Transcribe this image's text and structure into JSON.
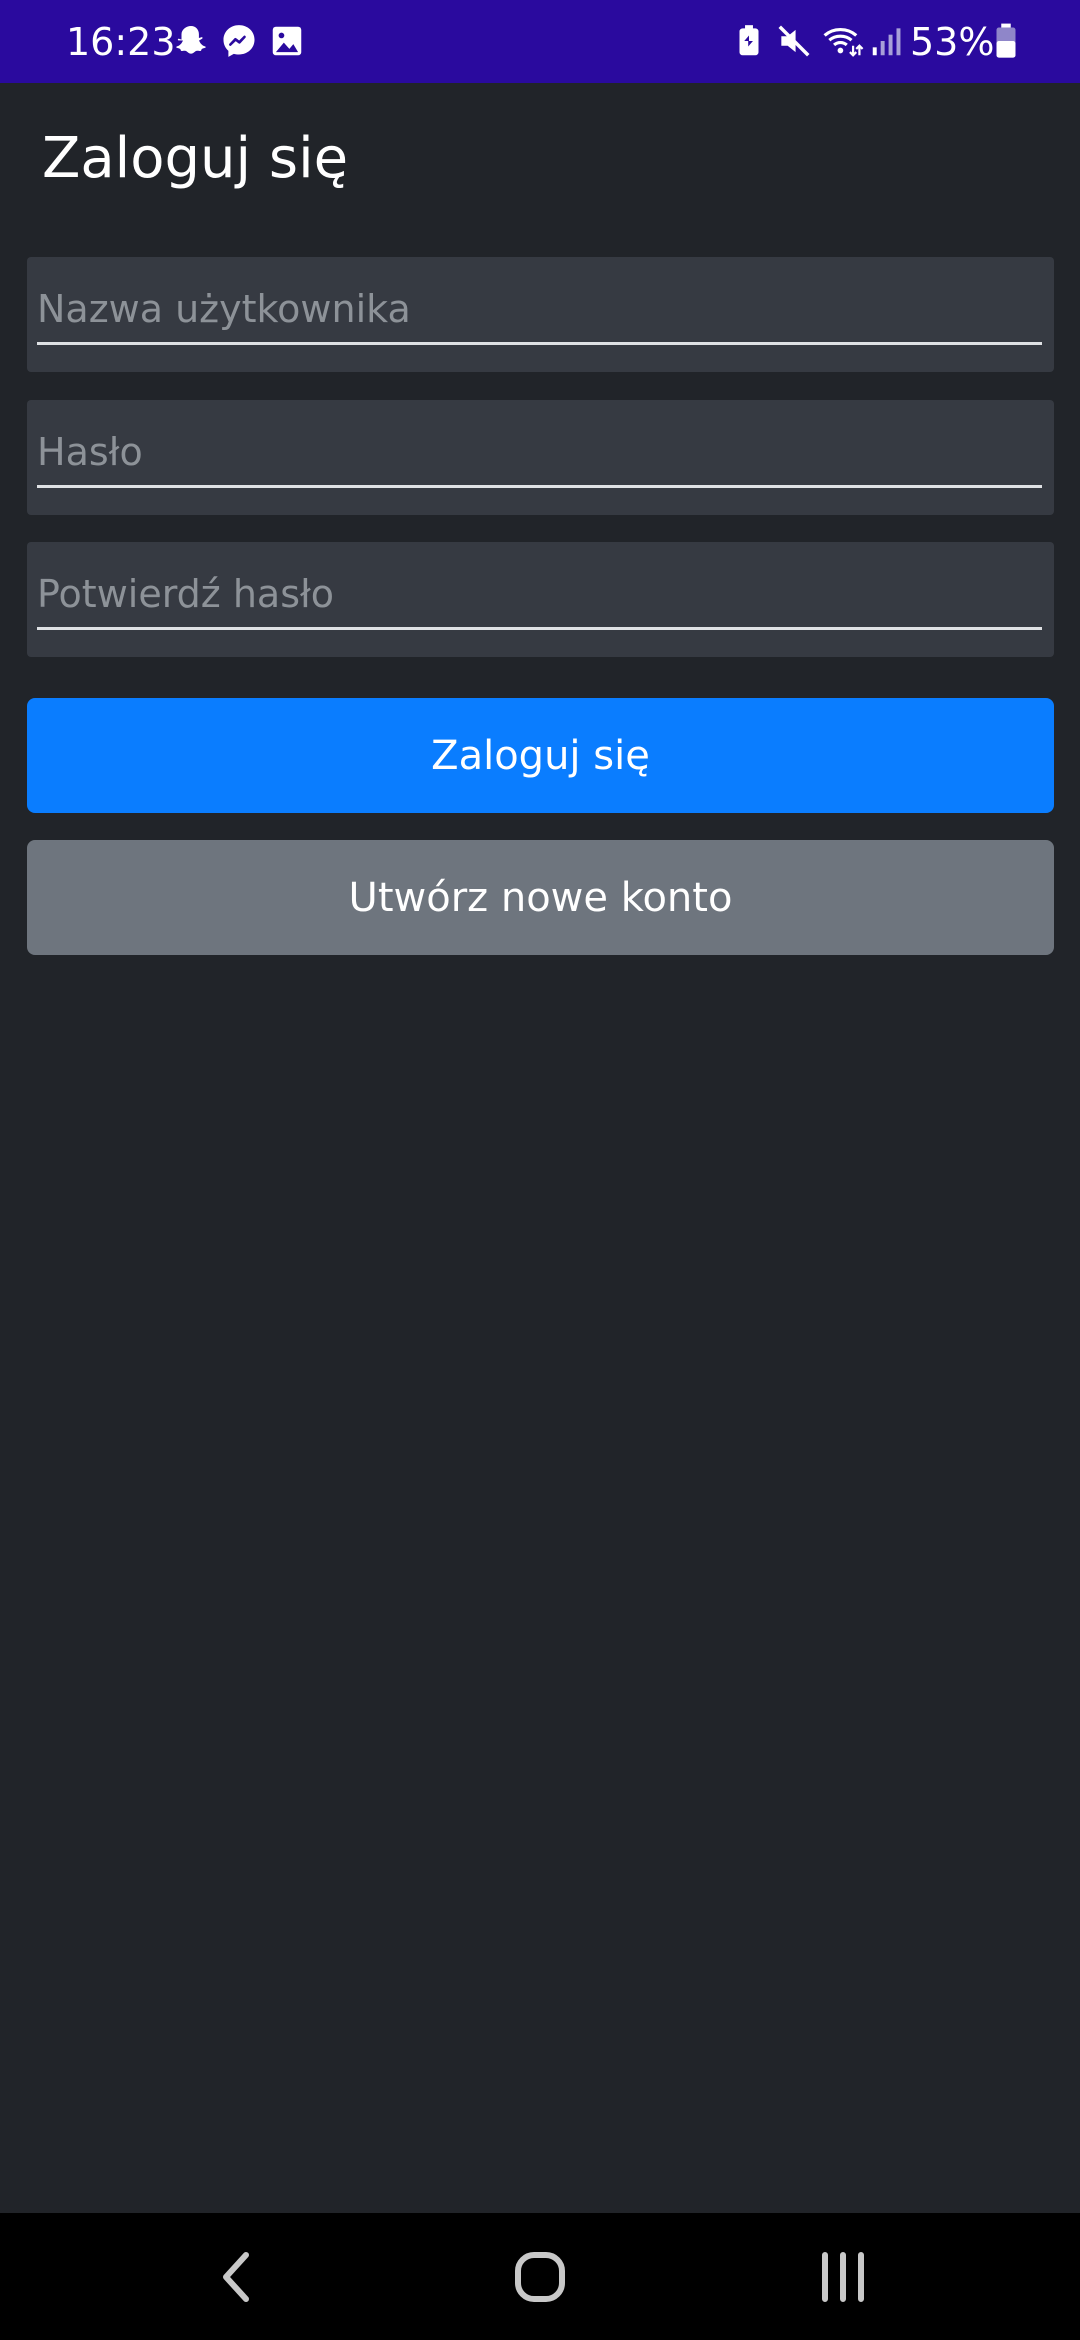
{
  "status_bar": {
    "time": "16:23",
    "left_icons": [
      "snapchat-icon",
      "messenger-icon",
      "gallery-icon"
    ],
    "right_icons": [
      "battery-saver-icon",
      "mute-icon",
      "wifi-icon",
      "signal-icon"
    ],
    "battery_percent": "53%",
    "background_color": "#2a0a9e"
  },
  "page": {
    "title": "Zaloguj się"
  },
  "form": {
    "username_placeholder": "Nazwa użytkownika",
    "password_placeholder": "Hasło",
    "confirm_password_placeholder": "Potwierdź hasło",
    "username_value": "",
    "password_value": "",
    "confirm_password_value": ""
  },
  "buttons": {
    "login_label": "Zaloguj się",
    "create_account_label": "Utwórz nowe konto",
    "primary_color": "#0a7dff",
    "secondary_color": "#6e757e"
  },
  "nav_bar": {
    "items": [
      "back-icon",
      "home-icon",
      "recent-apps-icon"
    ]
  }
}
